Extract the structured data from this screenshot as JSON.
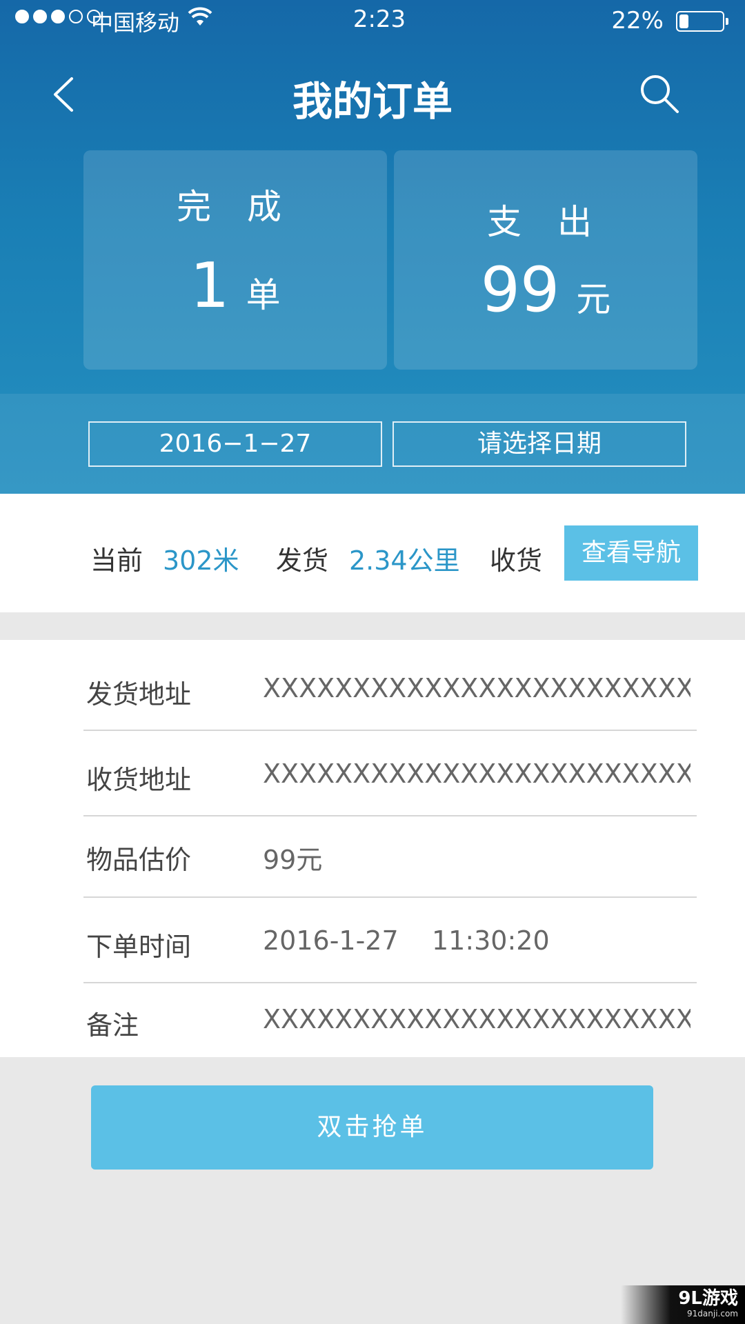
{
  "status_bar": {
    "carrier": "中国移动",
    "time": "2:23",
    "battery_percent": "22%",
    "battery_level": 0.22,
    "signal_bars_filled": 3,
    "signal_bars_total": 5,
    "icons": [
      "signal-dots-icon",
      "wifi-icon",
      "battery-icon"
    ]
  },
  "nav": {
    "title": "我的订单",
    "back_icon": "chevron-left-icon",
    "search_icon": "search-icon"
  },
  "stats": {
    "completed": {
      "label": "完 成",
      "value": "1",
      "unit": "单"
    },
    "expense": {
      "label": "支 出",
      "value": "99",
      "unit": "元"
    }
  },
  "date_filter": {
    "start": "2016−1−27",
    "end_placeholder": "请选择日期"
  },
  "distance": {
    "current_label": "当前",
    "current_value": "302米",
    "ship_label": "发货",
    "ship_value": "2.34公里",
    "receive_label": "收货",
    "nav_button": "查看导航"
  },
  "details": [
    {
      "label": "发货地址",
      "value": "XXXXXXXXXXXXXXXXXXXXXXXXX"
    },
    {
      "label": "收货地址",
      "value": "XXXXXXXXXXXXXXXXXXXXXXXXX"
    },
    {
      "label": "物品估价",
      "value": "99元"
    },
    {
      "label": "下单时间",
      "value": "2016-1-27    11:30:20"
    },
    {
      "label": "备注",
      "value": "XXXXXXXXXXXXXXXXXXXXXXXXX"
    }
  ],
  "action": {
    "grab_button": "双击抢单"
  },
  "watermark": {
    "main": "9L游戏",
    "sub": "91danji.com"
  },
  "colors": {
    "header_top": "#1568a8",
    "header_bottom": "#2590c0",
    "accent": "#5bc0e6",
    "link_value": "#2b96c8",
    "page_bg": "#e8e8e8"
  }
}
